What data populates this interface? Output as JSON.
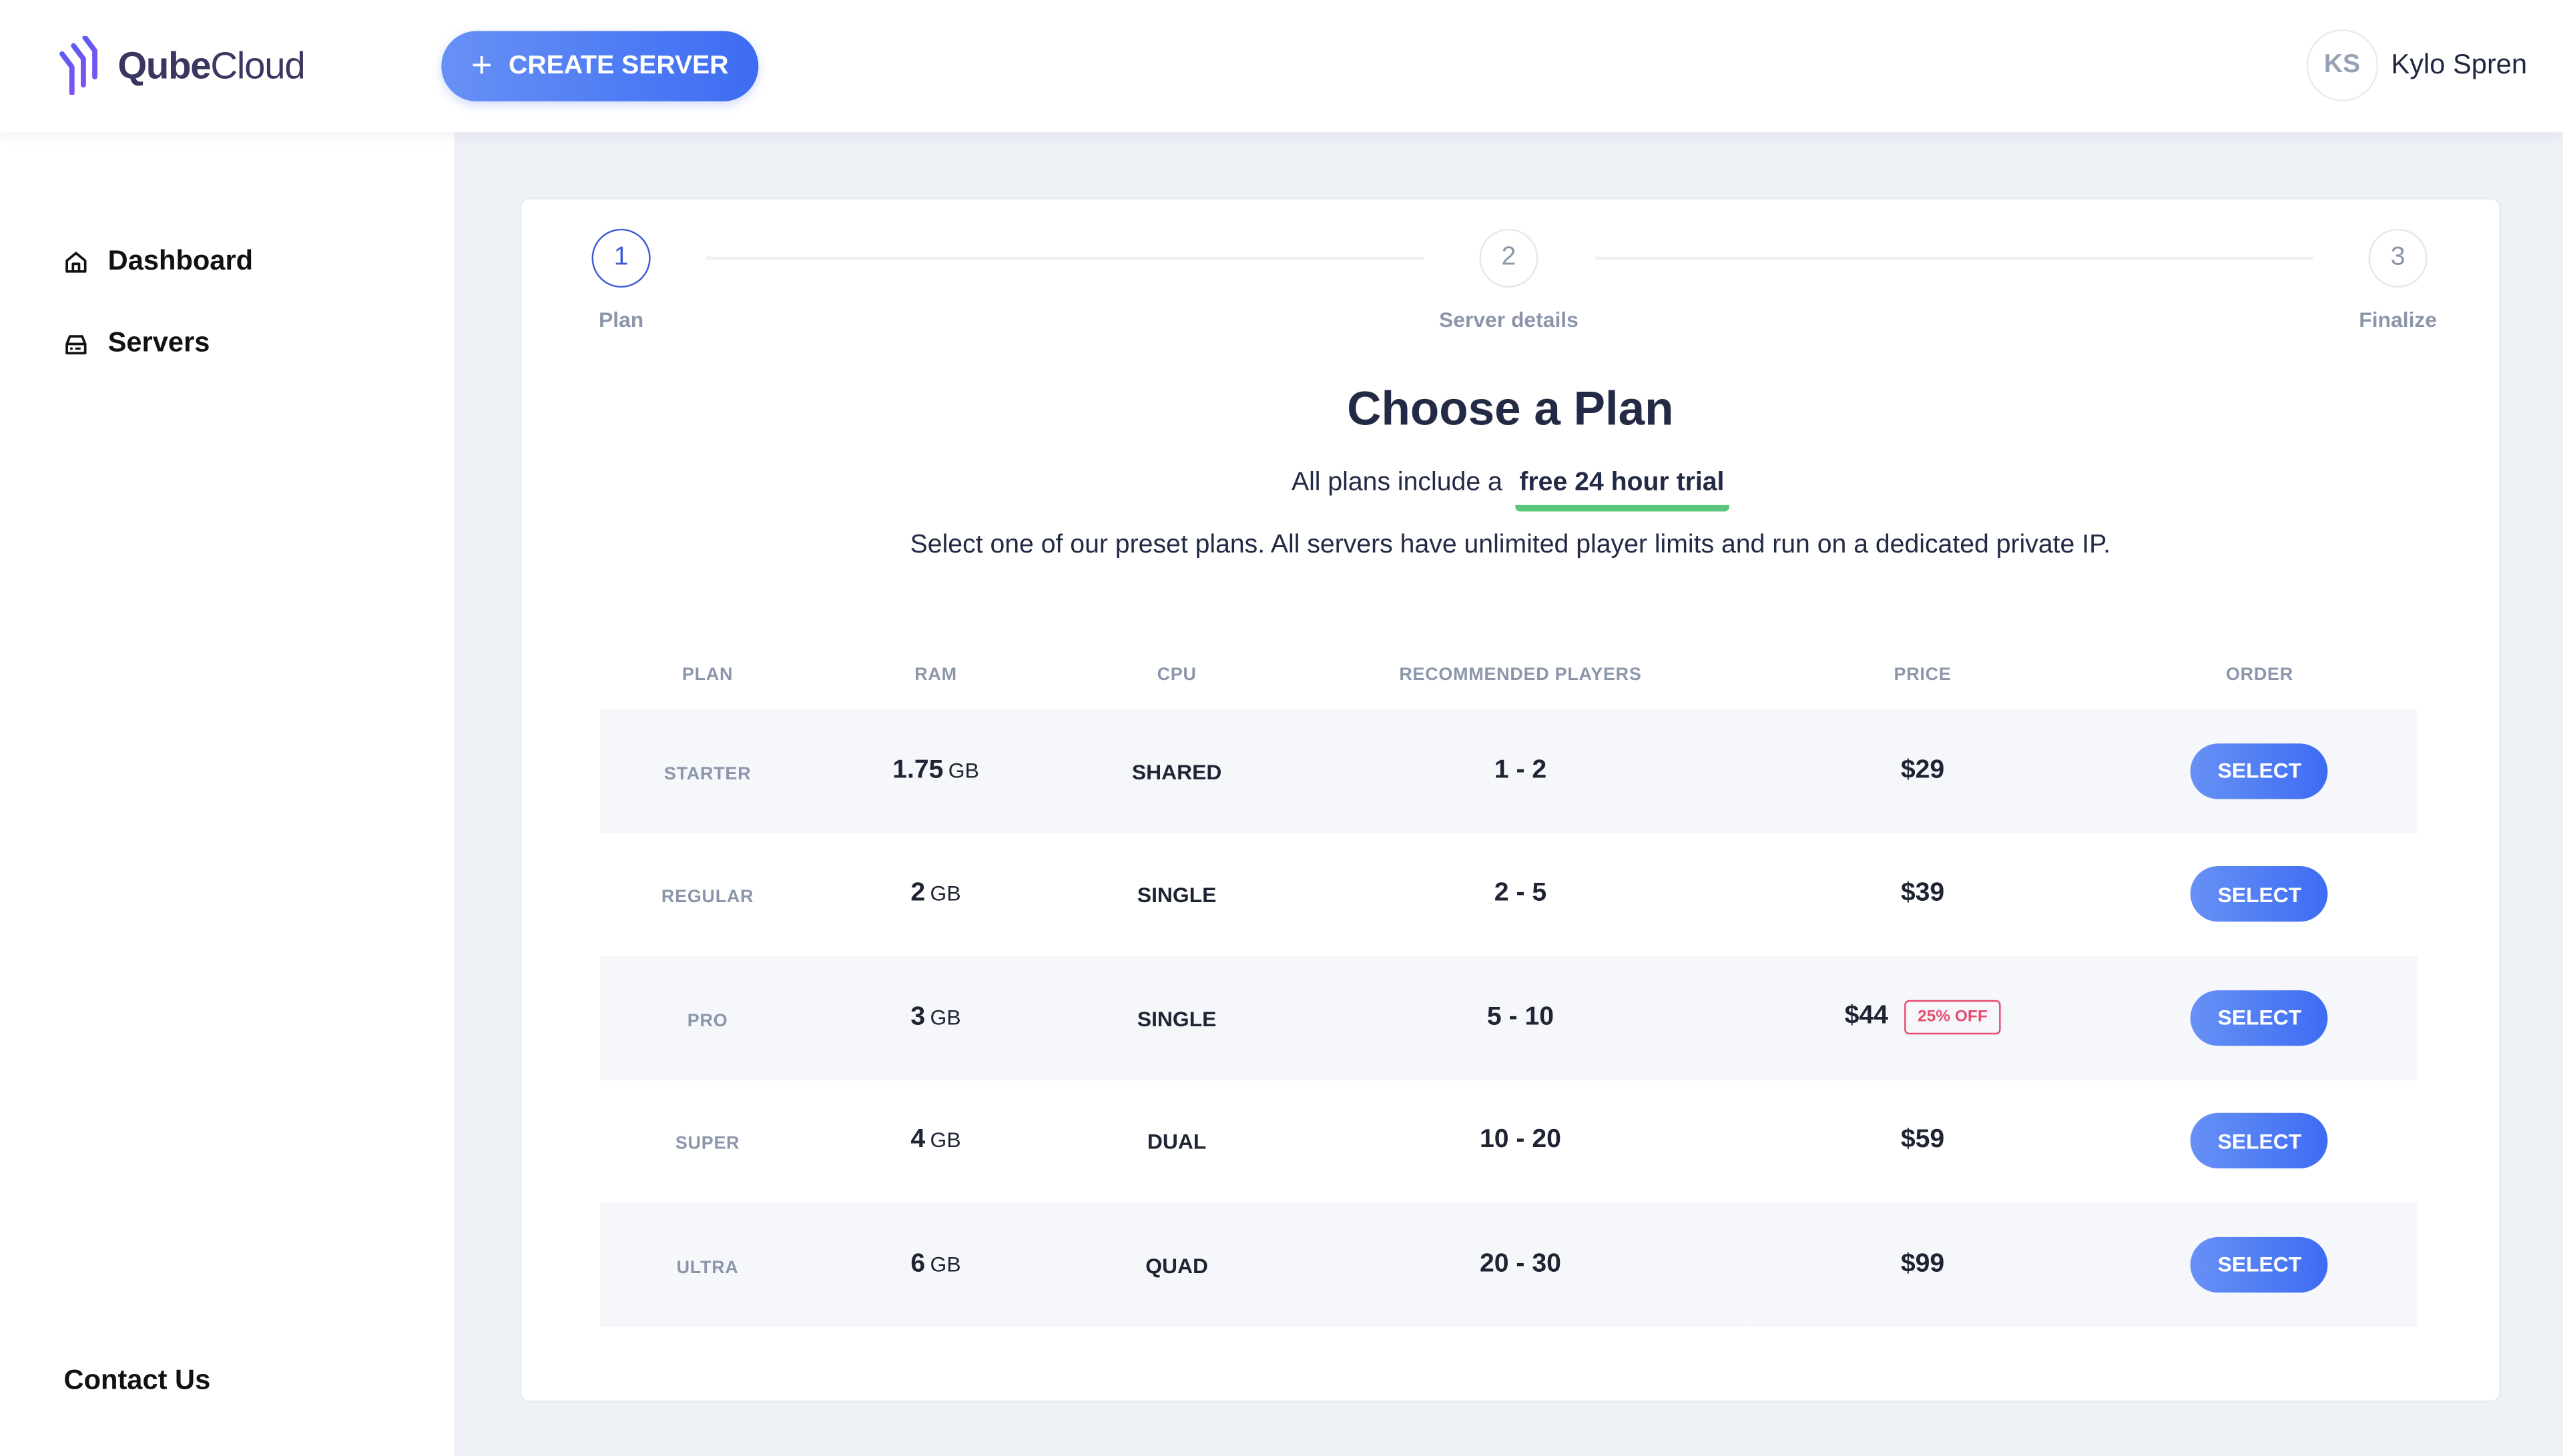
{
  "header": {
    "logo_bold": "Qube",
    "logo_light": "Cloud",
    "create_button": "CREATE SERVER",
    "user_initials": "KS",
    "user_name": "Kylo Spren"
  },
  "sidebar": {
    "items": [
      {
        "label": "Dashboard",
        "icon": "home-icon"
      },
      {
        "label": "Servers",
        "icon": "server-icon"
      }
    ],
    "footer_link": "Contact Us"
  },
  "stepper": {
    "steps": [
      {
        "number": "1",
        "label": "Plan",
        "active": true
      },
      {
        "number": "2",
        "label": "Server details",
        "active": false
      },
      {
        "number": "3",
        "label": "Finalize",
        "active": false
      }
    ]
  },
  "main": {
    "title": "Choose a Plan",
    "trial_prefix": "All plans include a",
    "trial_highlight": "free 24 hour trial",
    "description": "Select one of our preset plans. All servers have unlimited player limits and run on a dedicated private IP."
  },
  "table": {
    "headers": [
      "PLAN",
      "RAM",
      "CPU",
      "RECOMMENDED PLAYERS",
      "PRICE",
      "ORDER"
    ],
    "rows": [
      {
        "plan": "STARTER",
        "ram": "1.75",
        "ram_unit": "GB",
        "cpu": "SHARED",
        "players": "1 - 2",
        "price": "$29",
        "badge": "",
        "action": "SELECT"
      },
      {
        "plan": "REGULAR",
        "ram": "2",
        "ram_unit": "GB",
        "cpu": "SINGLE",
        "players": "2 - 5",
        "price": "$39",
        "badge": "",
        "action": "SELECT"
      },
      {
        "plan": "PRO",
        "ram": "3",
        "ram_unit": "GB",
        "cpu": "SINGLE",
        "players": "5 - 10",
        "price": "$44",
        "badge": "25% OFF",
        "action": "SELECT"
      },
      {
        "plan": "SUPER",
        "ram": "4",
        "ram_unit": "GB",
        "cpu": "DUAL",
        "players": "10 - 20",
        "price": "$59",
        "badge": "",
        "action": "SELECT"
      },
      {
        "plan": "ULTRA",
        "ram": "6",
        "ram_unit": "GB",
        "cpu": "QUAD",
        "players": "20 - 30",
        "price": "$99",
        "badge": "",
        "action": "SELECT"
      }
    ]
  },
  "colors": {
    "accent": "#3d6cf3",
    "highlight_underline": "#5bc77c",
    "discount": "#e74c6f",
    "page_bg": "#edf0f5"
  }
}
